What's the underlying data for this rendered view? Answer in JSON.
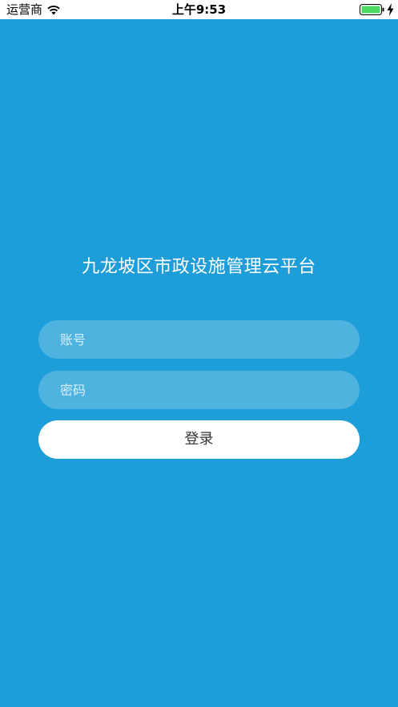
{
  "status_bar": {
    "carrier": "运营商",
    "time": "上午9:53",
    "icons": [
      "wifi-icon",
      "battery-icon",
      "charging-icon"
    ]
  },
  "login": {
    "title": "九龙坡区市政设施管理云平台",
    "account_placeholder": "账号",
    "password_placeholder": "密码",
    "login_label": "登录"
  },
  "colors": {
    "background": "#1E9ED8",
    "field_fill": "rgba(255,255,255,0.22)",
    "button_fill": "#FFFFFF",
    "battery_fill": "#4CD964"
  }
}
